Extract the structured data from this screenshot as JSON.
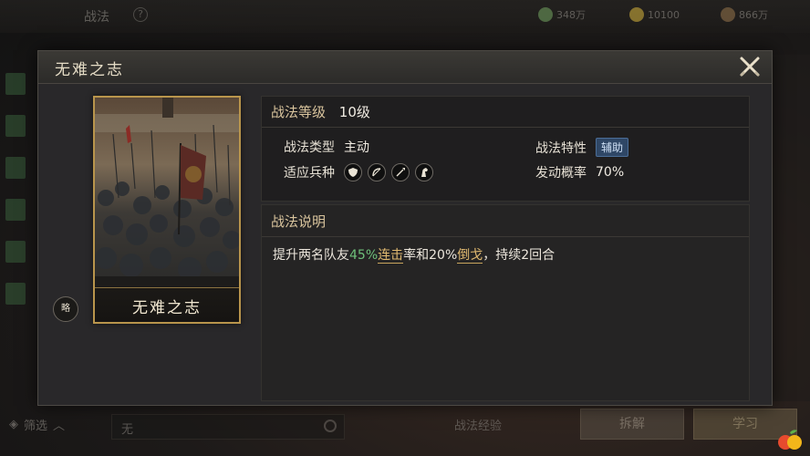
{
  "background": {
    "title": "战法",
    "help": "?",
    "resources": [
      {
        "value": "348万",
        "color": "#6d9a5c"
      },
      {
        "value": "10100",
        "color": "#c9a93a"
      },
      {
        "value": "866万",
        "color": "#8d6e48"
      }
    ],
    "filter_label": "筛选",
    "search_value": "无",
    "record_label": "战法经验",
    "button_1": "拆解",
    "button_2": "学习"
  },
  "modal": {
    "title": "无难之志",
    "card": {
      "name": "无难之志",
      "tag": "略"
    },
    "level": {
      "label": "战法等级",
      "value": "10级"
    },
    "type": {
      "label": "战法类型",
      "value": "主动"
    },
    "trait": {
      "label": "战法特性",
      "value": "辅助"
    },
    "troops": {
      "label": "适应兵种",
      "icons": [
        "shield-icon",
        "bow-icon",
        "spear-icon",
        "horse-icon"
      ]
    },
    "chance": {
      "label": "发动概率",
      "value": "70%"
    },
    "description": {
      "header": "战法说明",
      "part1": "提升两名队友",
      "pct1": "45%",
      "term1": "连击",
      "part2": "率和",
      "pct2": "20%",
      "term2": "倒戈",
      "part3": "，持续2回合"
    }
  },
  "colors": {
    "accent_gold": "#d9c49d",
    "highlight_green": "#6ec07a",
    "term_gold": "#e0b970",
    "trait_badge": "#2f4766"
  }
}
